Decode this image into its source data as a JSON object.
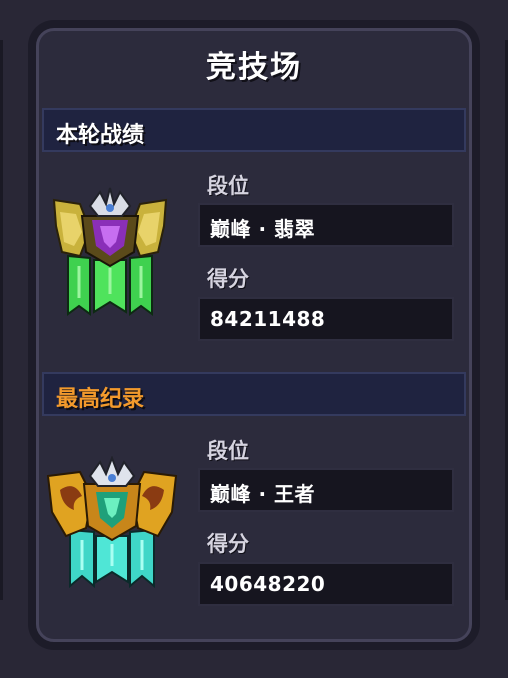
{
  "title": "竞技场",
  "current": {
    "header": "本轮战绩",
    "rank_label": "段位",
    "rank_value": "巅峰 · 翡翠",
    "score_label": "得分",
    "score_value": "84211488",
    "emblem_icon": "emerald-rank-emblem"
  },
  "best": {
    "header": "最高纪录",
    "rank_label": "段位",
    "rank_value": "巅峰 · 王者",
    "score_label": "得分",
    "score_value": "40648220",
    "emblem_icon": "king-rank-emblem"
  },
  "colors": {
    "best_header": "#f39a2c",
    "panel_bg": "#2c2b3c",
    "header_bg": "#1f2340"
  }
}
